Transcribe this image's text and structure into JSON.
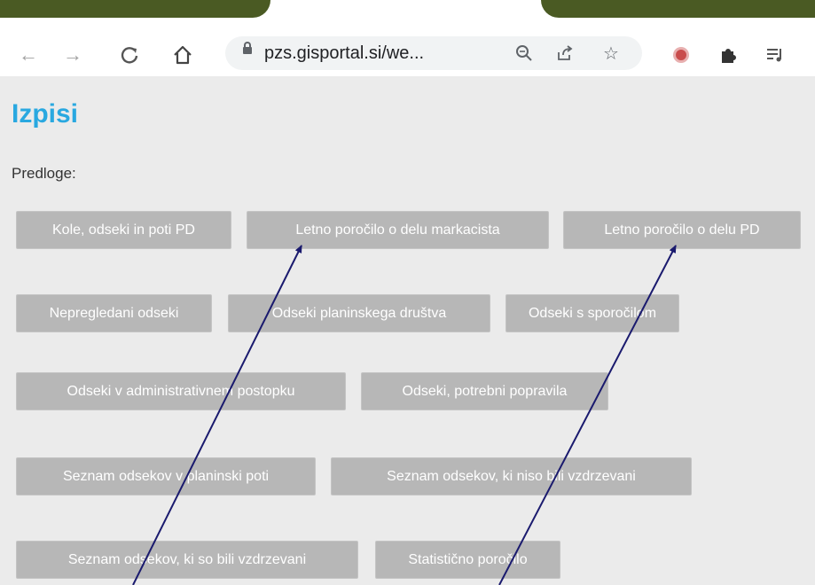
{
  "browser": {
    "url": "pzs.gisportal.si/we...",
    "icons": {
      "back": "back-arrow-icon",
      "forward": "forward-arrow-icon",
      "reload": "reload-icon",
      "home": "home-icon",
      "lock": "lock-icon",
      "zoom": "zoom-icon",
      "share": "share-icon",
      "bookmark": "star-icon",
      "extension": "extension-badge-icon",
      "puzzle": "puzzle-icon",
      "media": "media-list-icon"
    },
    "colors": {
      "tab_strip": "#4a5a23",
      "omnibox": "#f1f3f4"
    }
  },
  "page": {
    "title": "Izpisi",
    "templates_label": "Predloge:",
    "buttons": [
      "Kole, odseki in poti PD",
      "Letno poročilo o delu markacista",
      "Letno poročilo o delu PD",
      "Nepregledani odseki",
      "Odseki planinskega društva",
      "Odseki s sporočilom",
      "Odseki v administrativnem postopku",
      "Odseki, potrebni popravila",
      "Seznam odsekov v planinski poti",
      "Seznam odsekov, ki niso bili vzdrzevani",
      "Seznam odsekov, ki so bili vzdrzevani",
      "Statistično poročilo"
    ],
    "colors": {
      "title": "#29a8e0",
      "button_bg": "#b7b7b7",
      "button_text": "#ffffff",
      "background": "#ebebeb"
    }
  },
  "annotations": {
    "arrow_color": "#1a1a6e",
    "arrow_count": 2
  }
}
